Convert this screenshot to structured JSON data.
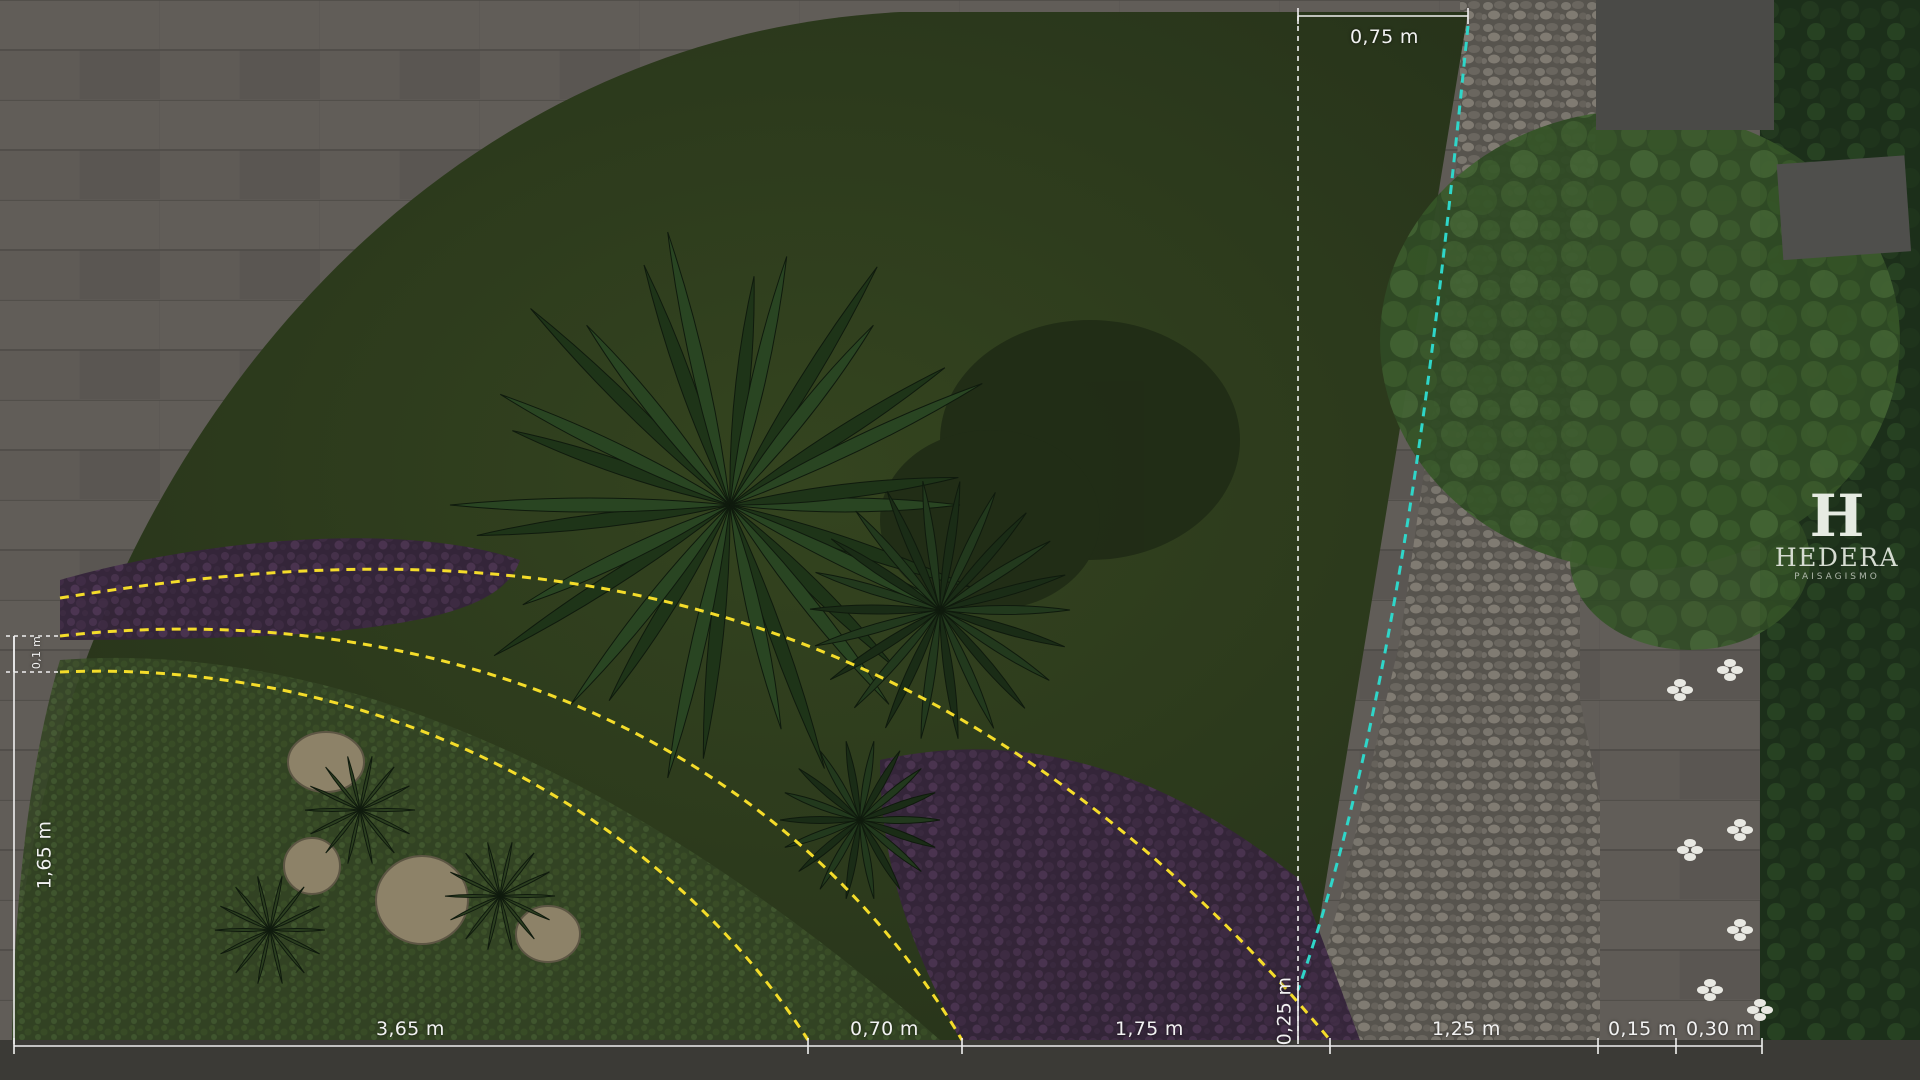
{
  "dimensions": {
    "top_width": "0,75 m",
    "height_left": "1,65 m",
    "gap_left_small": "0,1 m",
    "post_height": "0,25 m",
    "bottom": [
      "3,65 m",
      "0,70 m",
      "1,75 m",
      "1,25 m",
      "0,15 m",
      "0,30 m"
    ]
  },
  "brand": {
    "mark": "H",
    "name": "HEDERA",
    "tagline": "PAISAGISMO"
  },
  "colors": {
    "guide_yellow": "#f4dc2a",
    "guide_cyan": "#2fd6c9",
    "dim_line": "#f0f0f0",
    "lawn": "#2f3d1e",
    "paving": "#5e5a55",
    "gravel": "#6b6860",
    "purple_foliage": "#3d2a3f"
  }
}
